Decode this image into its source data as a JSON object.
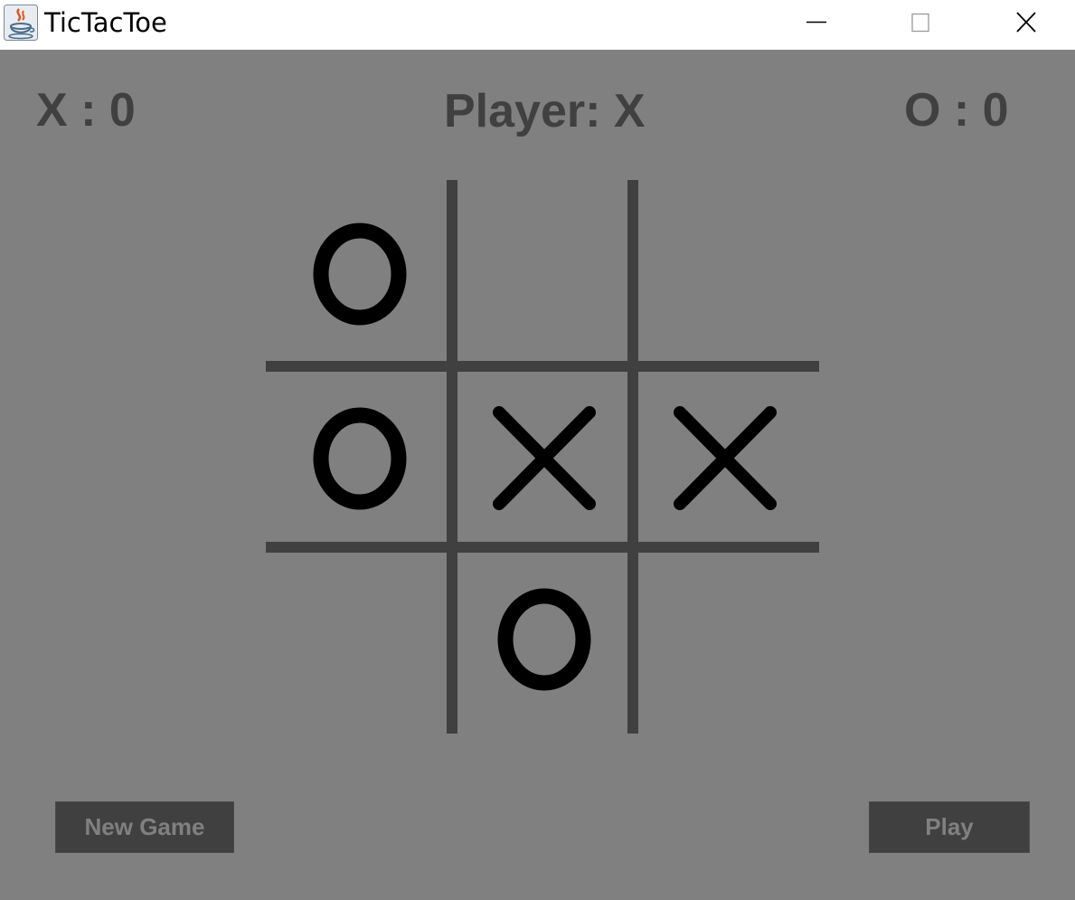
{
  "window": {
    "title": "TicTacToe",
    "icon": "java-cup-icon",
    "controls": [
      "minimize-icon",
      "maximize-icon",
      "close-icon"
    ]
  },
  "scores": {
    "x": "X : 0",
    "o": "O : 0"
  },
  "status": {
    "current_player": "Player: X"
  },
  "board": {
    "cells": [
      "O",
      "",
      "",
      "O",
      "X",
      "X",
      "",
      "O",
      ""
    ]
  },
  "buttons": {
    "new_game": "New Game",
    "play": "Play"
  },
  "colors": {
    "background": "#808080",
    "text": "#404040",
    "grid": "#404040",
    "marks": "#000000",
    "button_bg": "#404040",
    "button_text": "#808080"
  }
}
